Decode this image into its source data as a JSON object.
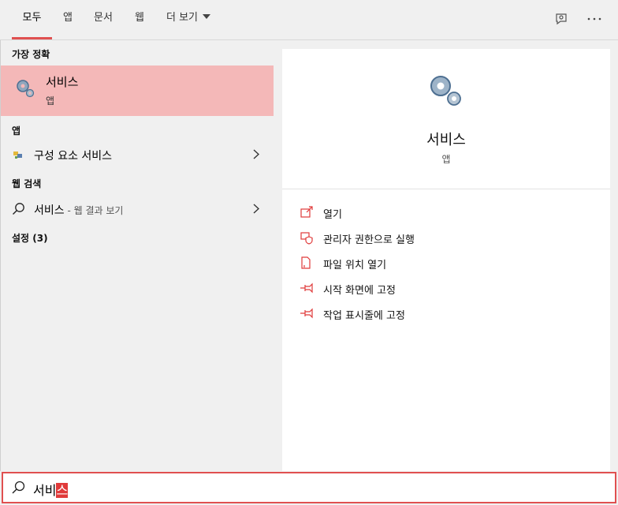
{
  "tabs": [
    {
      "label": "모두",
      "active": true
    },
    {
      "label": "앱"
    },
    {
      "label": "문서"
    },
    {
      "label": "웹"
    },
    {
      "label": "더 보기"
    }
  ],
  "toolbar": {
    "feedback_icon": "feedback-icon",
    "more_icon": "more-icon"
  },
  "left": {
    "best_header": "가장 정확",
    "best": {
      "title": "서비스",
      "sub": "앱",
      "icon": "services-gear-icon"
    },
    "apps_header": "앱",
    "apps": [
      {
        "label": "구성 요소 서비스",
        "icon": "component-services-icon"
      }
    ],
    "web_header": "웹 검색",
    "web": [
      {
        "label": "서비스",
        "suffix": " - 웹 결과 보기",
        "icon": "search-icon"
      }
    ],
    "settings_header": "설정 (3)"
  },
  "detail": {
    "name": "서비스",
    "type": "앱",
    "icon": "services-gear-icon",
    "actions": [
      {
        "label": "열기",
        "icon": "open-icon"
      },
      {
        "label": "관리자 권한으로 실행",
        "icon": "admin-shield-icon"
      },
      {
        "label": "파일 위치 열기",
        "icon": "file-location-icon"
      },
      {
        "label": "시작 화면에 고정",
        "icon": "pin-icon"
      },
      {
        "label": "작업 표시줄에 고정",
        "icon": "pin-icon"
      }
    ]
  },
  "search": {
    "typed": "서비",
    "selected": "스",
    "icon": "search-icon"
  },
  "colors": {
    "accent": "#e05050",
    "highlight": "#f4b8b8",
    "selection": "#e03a3a"
  }
}
